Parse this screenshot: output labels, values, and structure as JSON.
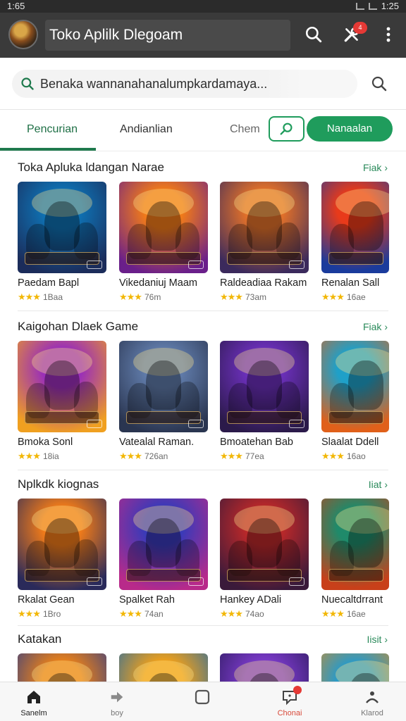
{
  "status_bar": {
    "time": "1:65",
    "clock_right": "1:25"
  },
  "app_bar": {
    "title": "Toko Aplilk Dlegoam",
    "notification_count": "4"
  },
  "search": {
    "text": "Benaka wannanahanalumpkardamaya..."
  },
  "tabs": {
    "items": [
      {
        "label": "Pencurian"
      },
      {
        "label": "Andianlian"
      },
      {
        "label": "Chem"
      }
    ],
    "cta_label": "Nanaalan"
  },
  "sections": [
    {
      "title": "Toka Apluka ldangan Narae",
      "more": "Fiak",
      "apps": [
        {
          "name": "Paedam Bapl",
          "stars": "★★★",
          "size": "1Baa",
          "color1": "#0f6fb0",
          "color2": "#1b2c5a"
        },
        {
          "name": "Vikedaniuj Maam",
          "stars": "★★★",
          "size": "76m",
          "color1": "#f07a1a",
          "color2": "#6a1f8a"
        },
        {
          "name": "Raldeadiaa Rakam",
          "stars": "★★★",
          "size": "73am",
          "color1": "#e0702a",
          "color2": "#3b2a5c"
        },
        {
          "name": "Renalan Sall",
          "stars": "★★★",
          "size": "16ae",
          "color1": "#e83a1a",
          "color2": "#1a3b9c"
        }
      ]
    },
    {
      "title": "Kaigohan Dlaek Game",
      "more": "Fiak",
      "apps": [
        {
          "name": "Bmoka Sonl",
          "stars": "★★★",
          "size": "18ia",
          "color1": "#9a2fb8",
          "color2": "#f0a020"
        },
        {
          "name": "Vatealal Raman.",
          "stars": "★★★",
          "size": "726an",
          "color1": "#5f7aa8",
          "color2": "#2a3550"
        },
        {
          "name": "Bmoatehan Bab",
          "stars": "★★★",
          "size": "77ea",
          "color1": "#6a2fb8",
          "color2": "#2b1a4a"
        },
        {
          "name": "Slaalat Ddell",
          "stars": "★★★",
          "size": "16ao",
          "color1": "#1fa0c8",
          "color2": "#e0601a"
        }
      ]
    },
    {
      "title": "Nplkdk kiognas",
      "more": "Iiat",
      "apps": [
        {
          "name": "Rkalat Gean",
          "stars": "★★★",
          "size": "1Bro",
          "color1": "#ee7a1a",
          "color2": "#2a2a5a"
        },
        {
          "name": "Spalket Rah",
          "stars": "★★★",
          "size": "74an",
          "color1": "#3a3ab8",
          "color2": "#b82a8a"
        },
        {
          "name": "Hankey ADali",
          "stars": "★★★",
          "size": "74ao",
          "color1": "#b8282a",
          "color2": "#3a1a3a"
        },
        {
          "name": "Nuecaltdrrant",
          "stars": "★★★",
          "size": "16ae",
          "color1": "#1f8a6a",
          "color2": "#c8401a"
        }
      ]
    },
    {
      "title": "Katakan",
      "more": "Iisit",
      "apps": [
        {
          "name": "",
          "stars": "",
          "size": "",
          "color1": "#e8801a",
          "color2": "#2a3a8a"
        },
        {
          "name": "",
          "stars": "",
          "size": "",
          "color1": "#f0a01a",
          "color2": "#1f6aa8"
        },
        {
          "name": "",
          "stars": "",
          "size": "",
          "color1": "#7a3ac8",
          "color2": "#2a1a5a"
        },
        {
          "name": "",
          "stars": "",
          "size": "",
          "color1": "#2a9ac8",
          "color2": "#e08a1a"
        }
      ]
    }
  ],
  "bottom_nav": [
    {
      "label": "Sanelm"
    },
    {
      "label": "boy"
    },
    {
      "label": ""
    },
    {
      "label": "Chonai"
    },
    {
      "label": "Klarod"
    }
  ]
}
